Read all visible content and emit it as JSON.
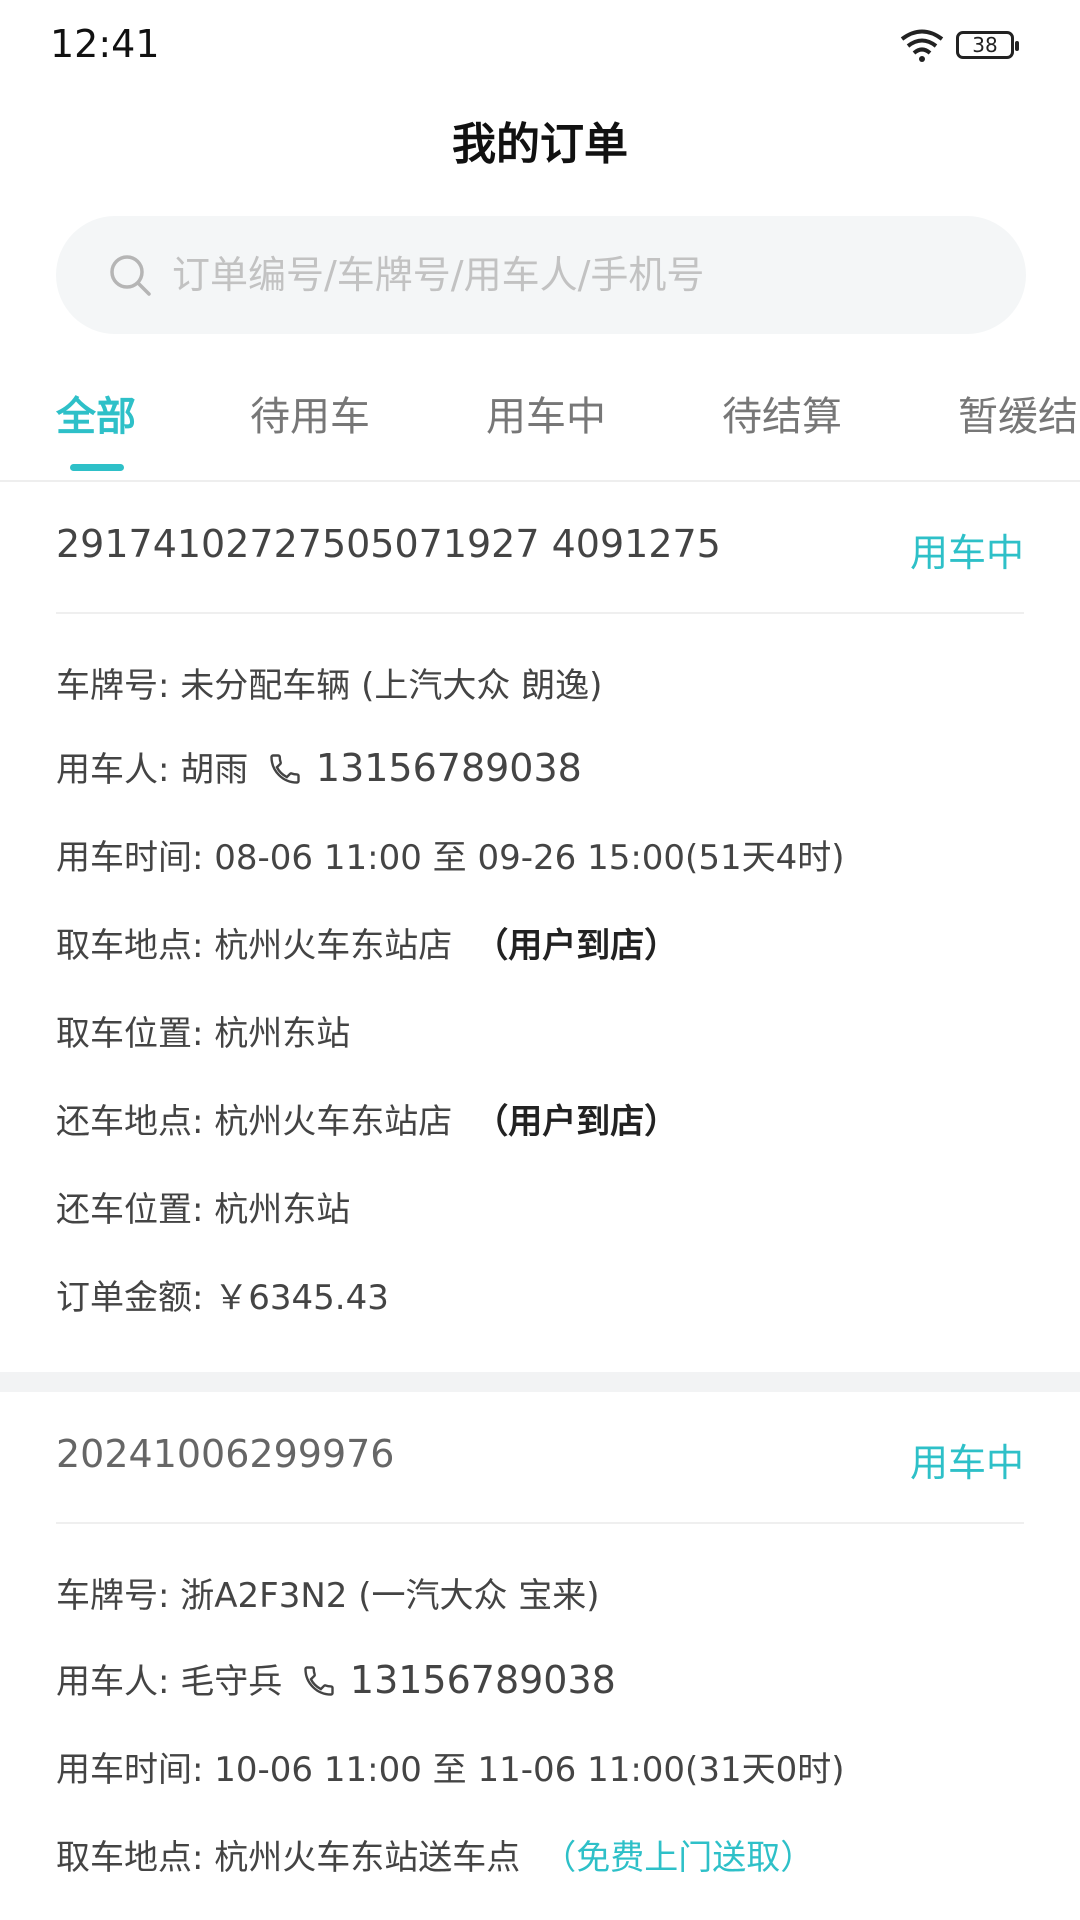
{
  "status_bar": {
    "time": "12:41",
    "battery": "38"
  },
  "title": "我的订单",
  "search": {
    "placeholder": "订单编号/车牌号/用车人/手机号"
  },
  "tabs": [
    {
      "label": "全部",
      "active": true
    },
    {
      "label": "待用车"
    },
    {
      "label": "用车中"
    },
    {
      "label": "待结算"
    },
    {
      "label": "暂缓结"
    }
  ],
  "orders": [
    {
      "order_no": "29174102727505071927 4091275",
      "status": "用车中",
      "plate": "车牌号: 未分配车辆 (上汽大众 朗逸)",
      "renter_label": "用车人: 胡雨",
      "phone": "13156789038",
      "time": "用车时间: 08-06 11:00 至 09-26 15:00(51天4时)",
      "pickup": "取车地点: 杭州火车东站店",
      "pickup_mode": "（用户到店）",
      "pickup_pos": "取车位置: 杭州东站",
      "return": "还车地点: 杭州火车东站店",
      "return_mode": "（用户到店）",
      "return_pos": "还车位置: 杭州东站",
      "amount": "订单金额: ￥6345.43"
    },
    {
      "order_no": "20241006299976",
      "status": "用车中",
      "plate": "车牌号: 浙A2F3N2 (一汽大众 宝来)",
      "renter_label": "用车人: 毛守兵",
      "phone": "13156789038",
      "time": "用车时间: 10-06 11:00 至 11-06 11:00(31天0时)",
      "pickup": "取车地点: 杭州火车东站送车点",
      "pickup_mode": "（免费上门送取）"
    }
  ],
  "colors": {
    "accent": "#2ec0c8"
  }
}
